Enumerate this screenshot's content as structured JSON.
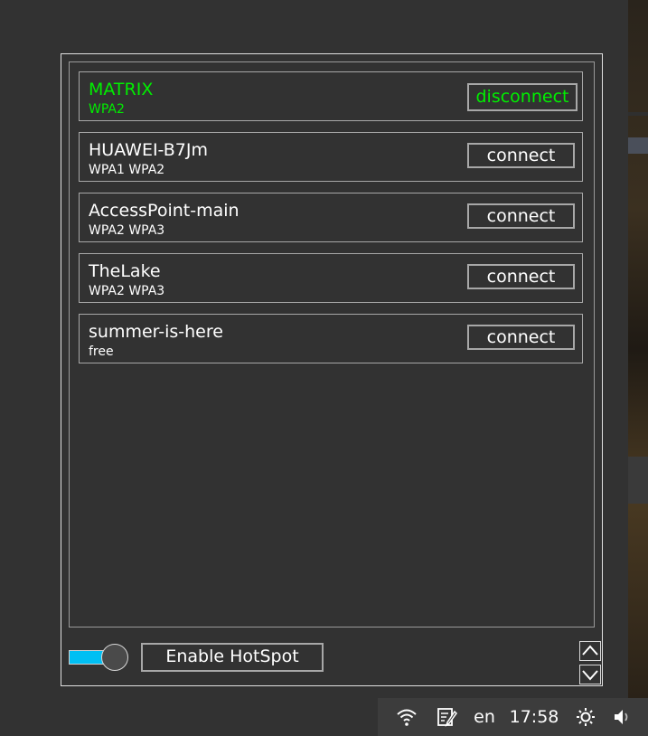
{
  "networks": [
    {
      "name": "MATRIX",
      "security": "WPA2",
      "action": "disconnect",
      "connected": true
    },
    {
      "name": "HUAWEI-B7Jm",
      "security": "WPA1 WPA2",
      "action": "connect",
      "connected": false
    },
    {
      "name": "AccessPoint-main",
      "security": "WPA2 WPA3",
      "action": "connect",
      "connected": false
    },
    {
      "name": "TheLake",
      "security": "WPA2 WPA3",
      "action": "connect",
      "connected": false
    },
    {
      "name": "summer-is-here",
      "security": "free",
      "action": "connect",
      "connected": false
    }
  ],
  "hotspot": {
    "toggle_on": true,
    "button_label": "Enable HotSpot"
  },
  "tray": {
    "wifi_icon": "wifi-icon",
    "notes_icon": "notepad-edit-icon",
    "language": "en",
    "clock": "17:58",
    "brightness_icon": "sun-icon",
    "volume_icon": "speaker-icon"
  },
  "colors": {
    "connected": "#00ee00",
    "toggle_track": "#00bff3",
    "background": "#323232",
    "tray_background": "#3c3c3c"
  }
}
